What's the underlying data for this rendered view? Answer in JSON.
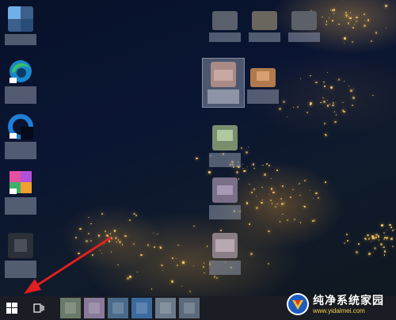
{
  "desktop": {
    "wallpaper": "night-satellite-europe",
    "icons_left": [
      {
        "id": "icon-1",
        "icon": "blurred-app-icon",
        "accent": "#5aa0e0"
      },
      {
        "id": "icon-2",
        "icon": "edge-icon",
        "accent": "#2e9bd6"
      },
      {
        "id": "icon-3",
        "icon": "edge-beta-icon",
        "accent": "#1f7fd8"
      },
      {
        "id": "icon-4",
        "icon": "edge-canary-icon",
        "accent": "#e64ea0"
      },
      {
        "id": "icon-5",
        "icon": "blurred-app-icon",
        "accent": "#7a7f8a"
      }
    ],
    "icons_right": [
      {
        "id": "icon-r1",
        "icon": "blurred-app-icon",
        "accent": "#8a909a"
      },
      {
        "id": "icon-r2",
        "icon": "blurred-app-icon",
        "accent": "#a09a90"
      },
      {
        "id": "icon-r3",
        "icon": "blurred-app-icon",
        "accent": "#90949c"
      },
      {
        "id": "icon-r4",
        "icon": "blurred-app-icon",
        "accent": "#b89890",
        "selected": true
      },
      {
        "id": "icon-r5",
        "icon": "blurred-app-icon",
        "accent": "#c49060"
      },
      {
        "id": "icon-r6",
        "icon": "blurred-app-icon",
        "accent": "#9ab08a"
      },
      {
        "id": "icon-r7",
        "icon": "blurred-app-icon",
        "accent": "#9a8aa8"
      },
      {
        "id": "icon-r8",
        "icon": "blurred-app-icon",
        "accent": "#a09098"
      }
    ]
  },
  "annotation": {
    "type": "red-arrow",
    "points_to": "start-button",
    "color": "#e02020"
  },
  "taskbar": {
    "start_icon": "windows-logo-icon",
    "task_view_icon": "task-view-icon",
    "pinned": [
      {
        "icon": "blurred-app-icon",
        "accent": "#6a7a6a"
      },
      {
        "icon": "blurred-app-icon",
        "accent": "#8a7a9a"
      },
      {
        "icon": "blurred-app-icon",
        "accent": "#4a6a8a"
      },
      {
        "icon": "blurred-app-icon",
        "accent": "#3a6aa0"
      },
      {
        "icon": "blurred-app-icon",
        "accent": "#6a7a8a"
      },
      {
        "icon": "blurred-app-icon",
        "accent": "#5a6a7a"
      }
    ]
  },
  "watermark": {
    "title": "纯净系统家园",
    "url": "www.yidaimei.com"
  }
}
